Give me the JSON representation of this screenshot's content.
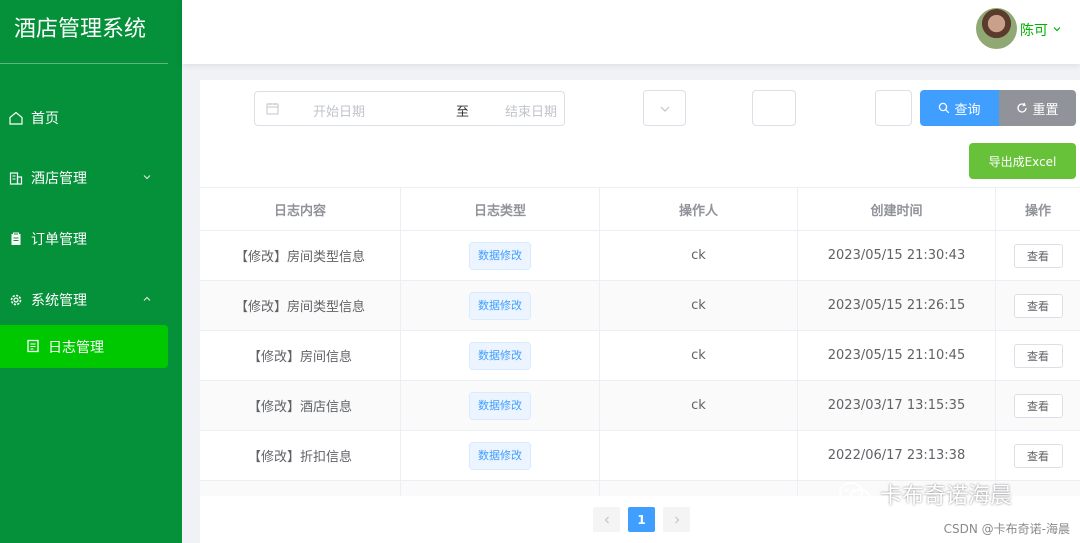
{
  "app": {
    "title": "酒店管理系统"
  },
  "sidebar": {
    "items": [
      {
        "label": "首页",
        "icon": "home-icon"
      },
      {
        "label": "酒店管理",
        "icon": "building-icon"
      },
      {
        "label": "订单管理",
        "icon": "clipboard-icon"
      },
      {
        "label": "系统管理",
        "icon": "gear-icon"
      }
    ],
    "active_sub": {
      "label": "日志管理",
      "icon": "document-icon"
    }
  },
  "header": {
    "user_name": "陈可"
  },
  "filters": {
    "start_placeholder": "开始日期",
    "separator": "至",
    "end_placeholder": "结束日期"
  },
  "buttons": {
    "search": "查询",
    "reset": "重置",
    "export": "导出成Excel",
    "view": "查看"
  },
  "table": {
    "headers": [
      "日志内容",
      "日志类型",
      "操作人",
      "创建时间",
      "操作"
    ],
    "rows": [
      {
        "content": "【修改】房间类型信息",
        "type": "数据修改",
        "operator": "ck",
        "time": "2023/05/15 21:30:43"
      },
      {
        "content": "【修改】房间类型信息",
        "type": "数据修改",
        "operator": "ck",
        "time": "2023/05/15 21:26:15"
      },
      {
        "content": "【修改】房间信息",
        "type": "数据修改",
        "operator": "ck",
        "time": "2023/05/15 21:10:45"
      },
      {
        "content": "【修改】酒店信息",
        "type": "数据修改",
        "operator": "ck",
        "time": "2023/03/17 13:15:35"
      },
      {
        "content": "【修改】折扣信息",
        "type": "数据修改",
        "operator": "",
        "time": "2022/06/17 23:13:38"
      }
    ]
  },
  "pagination": {
    "current_page": "1"
  },
  "watermark": {
    "large": "卡布奇诺海晨",
    "small": "CSDN @卡布奇诺-海晨"
  },
  "colors": {
    "sidebar": "#05903a",
    "active": "#00c800",
    "primary": "#409eff",
    "success": "#67c23a",
    "info": "#909399"
  }
}
